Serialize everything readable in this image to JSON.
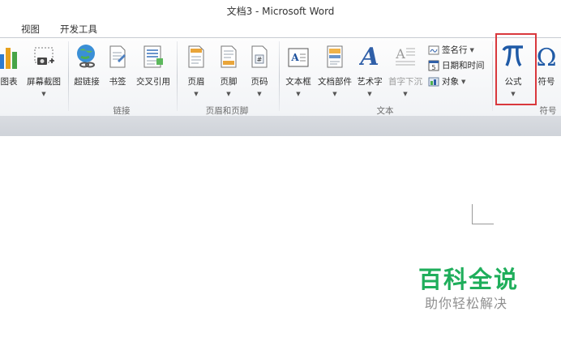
{
  "window": {
    "title": "文档3 - Microsoft Word"
  },
  "tabs": [
    {
      "label": "视图"
    },
    {
      "label": "开发工具"
    }
  ],
  "ribbon": {
    "buttons": [
      {
        "label": "图表"
      },
      {
        "label": "屏幕截图"
      },
      {
        "label": "超链接"
      },
      {
        "label": "书签"
      },
      {
        "label": "交叉引用"
      },
      {
        "label": "页眉"
      },
      {
        "label": "页脚"
      },
      {
        "label": "页码"
      },
      {
        "label": "文本框"
      },
      {
        "label": "文档部件"
      },
      {
        "label": "艺术字"
      },
      {
        "label": "首字下沉"
      },
      {
        "label": "公式"
      },
      {
        "label": "符号"
      }
    ],
    "small_buttons": [
      {
        "label": "签名行",
        "icon": "signature-line-icon"
      },
      {
        "label": "日期和时间",
        "icon": "date-time-icon"
      },
      {
        "label": "对象",
        "icon": "object-icon"
      }
    ],
    "groups": [
      {
        "label": "链接"
      },
      {
        "label": "页眉和页脚"
      },
      {
        "label": "文本"
      },
      {
        "label": "符号"
      }
    ]
  },
  "watermark": {
    "line1": "百科全说",
    "line2": "助你轻松解决",
    "color": "#1fae5b"
  },
  "colors": {
    "highlight": "#d9383d",
    "accent_blue": "#2f5fa8"
  }
}
